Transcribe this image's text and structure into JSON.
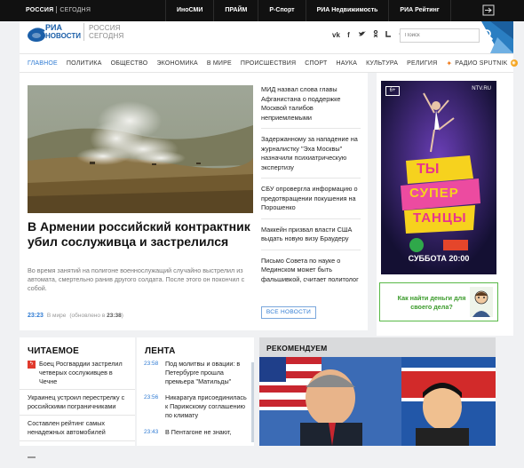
{
  "topbar": {
    "logo_left": "РОССИЯ",
    "logo_right": "СЕГОДНЯ",
    "links": [
      "ИноСМИ",
      "ПРАЙМ",
      "Р-Спорт",
      "РИА Недвижимость",
      "РИА Рейтинг"
    ],
    "exit_icon": "exit-icon"
  },
  "header": {
    "logo_ria": "РИА",
    "logo_novosti": "НОВОСТИ",
    "logo_rs_1": "РОССИЯ",
    "logo_rs_2": "СЕГОДНЯ",
    "socials": [
      "vk",
      "f",
      "y",
      "ok",
      "t",
      "tg"
    ],
    "social_glyphs": [
      "vk",
      "f",
      "✔",
      "◎",
      "ok",
      "◣"
    ],
    "search_placeholder": "Поиск"
  },
  "nav": {
    "items": [
      "ГЛАВНОЕ",
      "ПОЛИТИКА",
      "ОБЩЕСТВО",
      "ЭКОНОМИКА",
      "В МИРЕ",
      "ПРОИСШЕСТВИЯ",
      "СПОРТ",
      "НАУКА",
      "КУЛЬТУРА",
      "РЕЛИГИЯ"
    ],
    "active_index": 0,
    "sputnik_label": "РАДИО SPUTNIK"
  },
  "hero": {
    "title": "В Армении российский контрактник убил сослуживца и застрелился",
    "lead": "Во время занятий на полигоне военнослужащий случайно выстрелил из автомата, смертельно ранив другого солдата. После этого он покончил с собой.",
    "time": "23:23",
    "section": "В мире",
    "updated_prefix": "(обновлено в",
    "updated_time": "23:38",
    "updated_suffix": ")"
  },
  "side_news": [
    "МИД назвал слова главы Афганистана о поддержке Москвой талибов неприемлемыми",
    "Задержанному за нападение на журналистку \"Эха Москвы\" назначили психиатрическую экспертизу",
    "СБУ опровергла информацию о предотвращении покушения на Порошенко",
    "Маккейн призвал власти США выдать новую визу Браудеру",
    "Письмо Совета по науке о Мединском может быть фальшивкой, считает политолог"
  ],
  "all_news_label": "ВСЕ НОВОСТИ",
  "ad": {
    "age": "6+",
    "channel": "NTV.RU",
    "show_line1": "ТЫ",
    "show_line2": "СУПЕР",
    "show_line3": "ТАНЦЫ",
    "date_text": "СУББОТА 20:00",
    "ad2_text": "Как найти деньги для своего дела?"
  },
  "reading": {
    "title": "ЧИТАЕМОЕ",
    "items": [
      {
        "text": "Боец Росгвардии застрелил четверых сослуживцев в Чечне",
        "flash": true
      },
      {
        "text": "Украинец устроил перестрелку с российскими пограничниками",
        "flash": false
      },
      {
        "text": "Составлен рейтинг самых ненадежных автомобилей",
        "flash": false
      }
    ]
  },
  "lenta": {
    "title": "ЛЕНТА",
    "items": [
      {
        "time": "23:58",
        "text": "Под молитвы и овации: в Петербурге прошла премьера \"Матильды\""
      },
      {
        "time": "23:56",
        "text": "Никарагуа присоединилась к Парижскому соглашению по климату"
      },
      {
        "time": "23:43",
        "text": "В Пентагоне не знают,"
      }
    ]
  },
  "reco": {
    "title": "РЕКОМЕНДУЕМ"
  },
  "colors": {
    "accent": "#2f7bd3",
    "brand": "#1a5ea8",
    "topbar": "#111111",
    "flash": "#e03a2d",
    "ad_green": "#3a9a2a"
  }
}
